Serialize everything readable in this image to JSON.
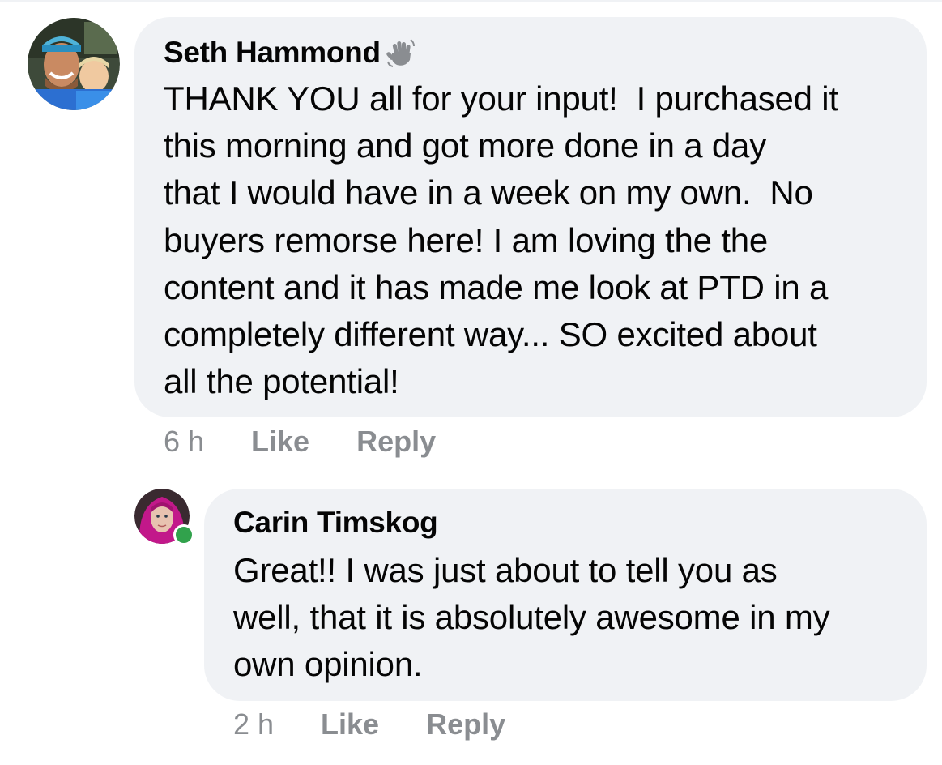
{
  "comments": [
    {
      "author": "Seth Hammond",
      "badge_icon": "wave-hand-icon",
      "text": "THANK YOU all for your input!  I purchased it\nthis morning and got more done in a day\nthat I would have in a week on my own.  No\nbuyers remorse here! I am loving the the\ncontent and it has made me look at PTD in a\ncompletely different way... SO excited about\nall the potential!",
      "time": "6 h",
      "like_label": "Like",
      "reply_label": "Reply"
    },
    {
      "author": "Carin Timskog",
      "online": true,
      "text": "Great!! I was just about to tell you as\nwell, that it is absolutely awesome in my\nown opinion.",
      "time": "2 h",
      "like_label": "Like",
      "reply_label": "Reply"
    }
  ],
  "colors": {
    "bubble": "#f0f2f5",
    "text": "#050505",
    "meta": "#8a8d91",
    "online": "#31a24c"
  }
}
